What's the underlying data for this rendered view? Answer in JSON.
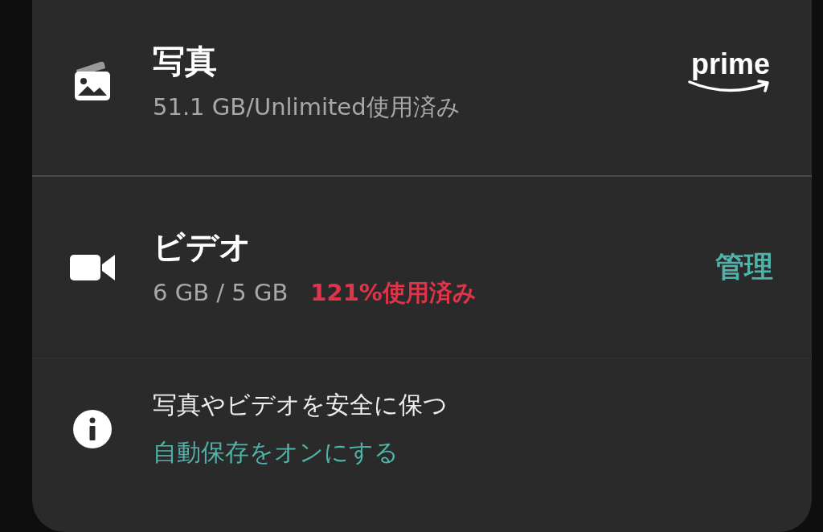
{
  "rows": [
    {
      "kind": "photos",
      "title": "写真",
      "usage": "51.1 GB/Unlimited使用済み",
      "badge": "prime"
    },
    {
      "kind": "video",
      "title": "ビデオ",
      "usage": "6 GB / 5 GB",
      "over_usage": "121%使用済み",
      "action": "管理"
    }
  ],
  "info": {
    "message": "写真やビデオを安全に保つ",
    "link": "自動保存をオンにする"
  }
}
